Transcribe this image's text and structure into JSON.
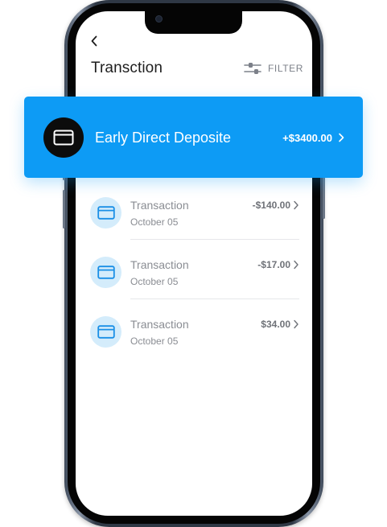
{
  "header": {
    "title": "Transction",
    "filter_label": "FILTER"
  },
  "highlight": {
    "title": "Early Direct Deposite",
    "amount": "+$3400.00",
    "accent_color": "#0d9bf5"
  },
  "transactions": [
    {
      "title": "Transaction",
      "date": "October 05",
      "amount": "-$140.00"
    },
    {
      "title": "Transaction",
      "date": "October 05",
      "amount": "-$17.00"
    },
    {
      "title": "Transaction",
      "date": "October 05",
      "amount": "$34.00"
    }
  ],
  "icons": {
    "back": "chevron-left-icon",
    "filter": "sliders-icon",
    "card": "credit-card-icon",
    "chevron": "chevron-right-icon"
  }
}
